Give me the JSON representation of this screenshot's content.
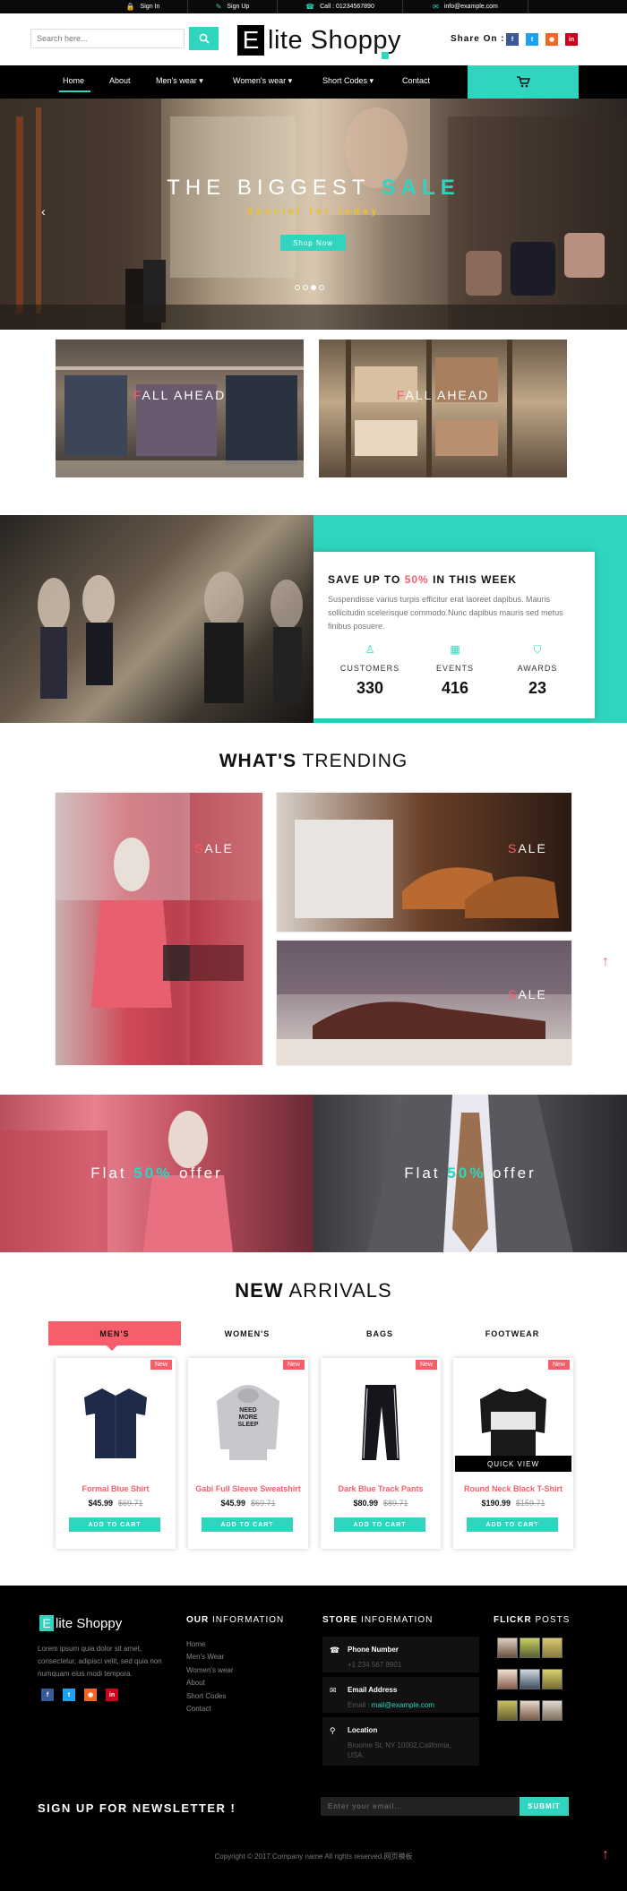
{
  "topbar": {
    "items": [
      {
        "icon": "lock-icon",
        "glyph": "🔒",
        "label": "Sign In"
      },
      {
        "icon": "edit-icon",
        "glyph": "✎",
        "label": "Sign Up"
      },
      {
        "icon": "phone-icon",
        "glyph": "☎",
        "label": "Call : 01234567890"
      },
      {
        "icon": "envelope-icon",
        "glyph": "✉",
        "label": "info@example.com"
      }
    ]
  },
  "header": {
    "search_placeholder": "Search here...",
    "logo_letter": "E",
    "logo_text": "lite Shoppy",
    "share_label": "Share On :",
    "socials": [
      {
        "name": "facebook",
        "glyph": "f",
        "color": "#3b5998"
      },
      {
        "name": "twitter",
        "glyph": "t",
        "color": "#1da1f2"
      },
      {
        "name": "rss",
        "glyph": "◉",
        "color": "#f26522"
      },
      {
        "name": "linkedin",
        "glyph": "in",
        "color": "#d0021b"
      }
    ]
  },
  "nav": {
    "items": [
      {
        "label": "Home",
        "active": true
      },
      {
        "label": "About"
      },
      {
        "label": "Men's wear ▾"
      },
      {
        "label": "Women's wear ▾"
      },
      {
        "label": "Short Codes ▾"
      },
      {
        "label": "Contact"
      }
    ]
  },
  "hero": {
    "title_a": "THE BIGGEST ",
    "title_b": "SALE",
    "subtitle": "Special for today",
    "button": "Shop Now",
    "slide_count": 4,
    "active_slide": 2
  },
  "promos": [
    {
      "first": "F",
      "rest": "ALL AHEAD"
    },
    {
      "first": "F",
      "rest": "ALL AHEAD"
    }
  ],
  "save": {
    "title_a": "SAVE UP TO ",
    "title_pct": "50%",
    "title_b": " IN THIS WEEK",
    "desc": "Suspendisse varius turpis efficitur erat laoreet dapibus. Mauris sollicitudin scelerisque commodo.Nunc dapibus mauris sed metus finibus posuere.",
    "stats": [
      {
        "icon": "user-icon",
        "glyph": "♙",
        "label": "CUSTOMERS",
        "value": "330"
      },
      {
        "icon": "calendar-icon",
        "glyph": "▦",
        "label": "EVENTS",
        "value": "416"
      },
      {
        "icon": "shield-icon",
        "glyph": "⛉",
        "label": "AWARDS",
        "value": "23"
      }
    ]
  },
  "trending": {
    "title_bold": "WHAT'S",
    "title_rest": " TRENDING",
    "tiles": [
      {
        "first": "S",
        "rest": "ALE"
      },
      {
        "first": "S",
        "rest": "ALE"
      },
      {
        "first": "S",
        "rest": "ALE"
      }
    ]
  },
  "offers": [
    {
      "a": "Flat ",
      "b": "50%",
      "c": " offer"
    },
    {
      "a": "Flat ",
      "b": "50%",
      "c": " offer"
    }
  ],
  "arrivals": {
    "title_bold": "NEW",
    "title_rest": " ARRIVALS",
    "tabs": [
      "MEN'S",
      "WOMEN'S",
      "BAGS",
      "FOOTWEAR"
    ],
    "products": [
      {
        "badge": "New",
        "name": "Formal Blue Shirt",
        "price": "$45.99",
        "old": "$69.71",
        "button": "ADD TO CART"
      },
      {
        "badge": "New",
        "name": "Gabi Full Sleeve Sweatshirt",
        "price": "$45.99",
        "old": "$69.71",
        "button": "ADD TO CART",
        "print": "NEED MORE SLEEP"
      },
      {
        "badge": "New",
        "name": "Dark Blue Track Pants",
        "price": "$80.99",
        "old": "$89.71",
        "button": "ADD TO CART"
      },
      {
        "badge": "New",
        "name": "Round Neck Black T-Shirt",
        "price": "$190.99",
        "old": "$159.71",
        "button": "ADD TO CART",
        "quick": "QUICK VIEW"
      }
    ]
  },
  "footer": {
    "logo_letter": "E",
    "logo_text": "lite Shoppy",
    "desc": "Lorem ipsum quia dolor sit amet, consectetur, adipisci velit, sed quia non numquam eius modi tempora.",
    "info_title_bold": "OUR",
    "info_title_rest": " INFORMATION",
    "links": [
      "Home",
      "Men's Wear",
      "Women's wear",
      "About",
      "Short Codes",
      "Contact"
    ],
    "store_title_bold": "STORE",
    "store_title_rest": " INFORMATION",
    "store": [
      {
        "icon": "phone-icon",
        "glyph": "☎",
        "title": "Phone Number",
        "value": "+1 234 567 8901"
      },
      {
        "icon": "envelope-icon",
        "glyph": "✉",
        "title": "Email Address",
        "value_label": "Email : ",
        "value": "mail@example.com"
      },
      {
        "icon": "location-icon",
        "glyph": "⚲",
        "title": "Location",
        "value": "Broome St, NY 10002,California, USA."
      }
    ],
    "flickr_title_bold": "FLICKR",
    "flickr_title_rest": " POSTS",
    "newsletter_title": "SIGN UP FOR NEWSLETTER !",
    "newsletter_placeholder": "Enter your email...",
    "newsletter_button": "SUBMIT",
    "copyright": "Copyright © 2017.Company name All rights reserved.网页模板"
  }
}
